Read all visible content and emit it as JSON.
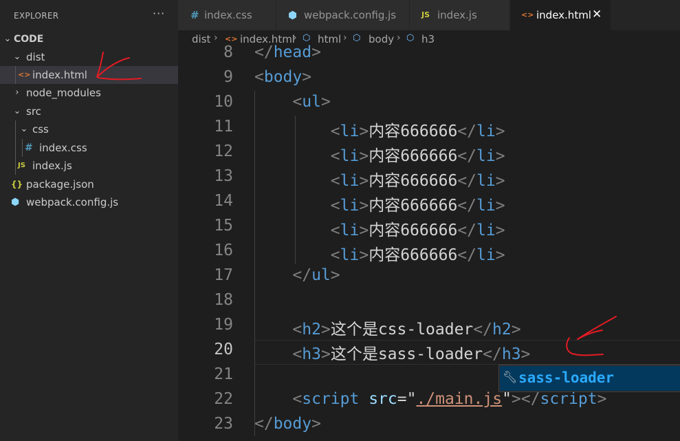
{
  "explorer": {
    "header": "EXPLORER",
    "more": "···",
    "root": "CODE",
    "items": [
      {
        "label": "dist",
        "chevron": "⌄",
        "icon": ""
      },
      {
        "label": "index.html",
        "chevron": "",
        "icon": "<>"
      },
      {
        "label": "node_modules",
        "chevron": "›",
        "icon": ""
      },
      {
        "label": "src",
        "chevron": "⌄",
        "icon": ""
      },
      {
        "label": "css",
        "chevron": "⌄",
        "icon": ""
      },
      {
        "label": "index.css",
        "chevron": "",
        "icon": "#"
      },
      {
        "label": "index.js",
        "chevron": "",
        "icon": "JS"
      },
      {
        "label": "package.json",
        "chevron": "",
        "icon": "{}"
      },
      {
        "label": "webpack.config.js",
        "chevron": "",
        "icon": "⬢"
      }
    ]
  },
  "tabs": [
    {
      "label": "index.css",
      "icon": "#"
    },
    {
      "label": "webpack.config.js",
      "icon": "⬢"
    },
    {
      "label": "index.js",
      "icon": "JS"
    },
    {
      "label": "index.html",
      "icon": "<>",
      "close": "✕"
    }
  ],
  "breadcrumb": [
    "dist",
    "index.html",
    "html",
    "body",
    "h3"
  ],
  "editor": {
    "line_numbers": [
      "8",
      "9",
      "10",
      "11",
      "12",
      "13",
      "14",
      "15",
      "16",
      "17",
      "18",
      "19",
      "20",
      "21",
      "22",
      "23"
    ],
    "current_line": "20",
    "lines": [
      {
        "indent": "",
        "open": "</",
        "tag": "head",
        "close": ">"
      },
      {
        "indent": "",
        "open": "<",
        "tag": "body",
        "close": ">"
      },
      {
        "indent": "    ",
        "open": "<",
        "tag": "ul",
        "close": ">"
      },
      {
        "indent": "        ",
        "open": "<",
        "tag": "li",
        "close": ">",
        "text": "内容666666",
        "open2": "</",
        "tag2": "li",
        "close2": ">"
      },
      {
        "indent": "        ",
        "open": "<",
        "tag": "li",
        "close": ">",
        "text": "内容666666",
        "open2": "</",
        "tag2": "li",
        "close2": ">"
      },
      {
        "indent": "        ",
        "open": "<",
        "tag": "li",
        "close": ">",
        "text": "内容666666",
        "open2": "</",
        "tag2": "li",
        "close2": ">"
      },
      {
        "indent": "        ",
        "open": "<",
        "tag": "li",
        "close": ">",
        "text": "内容666666",
        "open2": "</",
        "tag2": "li",
        "close2": ">"
      },
      {
        "indent": "        ",
        "open": "<",
        "tag": "li",
        "close": ">",
        "text": "内容666666",
        "open2": "</",
        "tag2": "li",
        "close2": ">"
      },
      {
        "indent": "        ",
        "open": "<",
        "tag": "li",
        "close": ">",
        "text": "内容666666",
        "open2": "</",
        "tag2": "li",
        "close2": ">"
      },
      {
        "indent": "    ",
        "open": "</",
        "tag": "ul",
        "close": ">"
      },
      {
        "indent": ""
      },
      {
        "indent": "    ",
        "open": "<",
        "tag": "h2",
        "close": ">",
        "text": "这个是css-loader",
        "open2": "</",
        "tag2": "h2",
        "close2": ">"
      },
      {
        "indent": "    ",
        "open": "<",
        "tag": "h3",
        "close": ">",
        "text": "这个是sass-loader",
        "open2": "</",
        "tag2": "h3",
        "close2": ">"
      },
      {
        "indent": ""
      },
      {
        "indent": "    ",
        "open": "<",
        "tag": "script",
        "attr": " src",
        "eq": "=\"",
        "str": "./main.js",
        "q": "\"",
        "close": ">",
        "open2": "</",
        "tag2": "script",
        "close2": ">"
      },
      {
        "indent": "",
        "open": "</",
        "tag": "body",
        "close": ">"
      }
    ]
  },
  "suggestion": {
    "icon": "wrench-icon",
    "label": "sass-loader"
  },
  "colors": {
    "annotation": "#e51b23",
    "accent": "#007acc"
  }
}
